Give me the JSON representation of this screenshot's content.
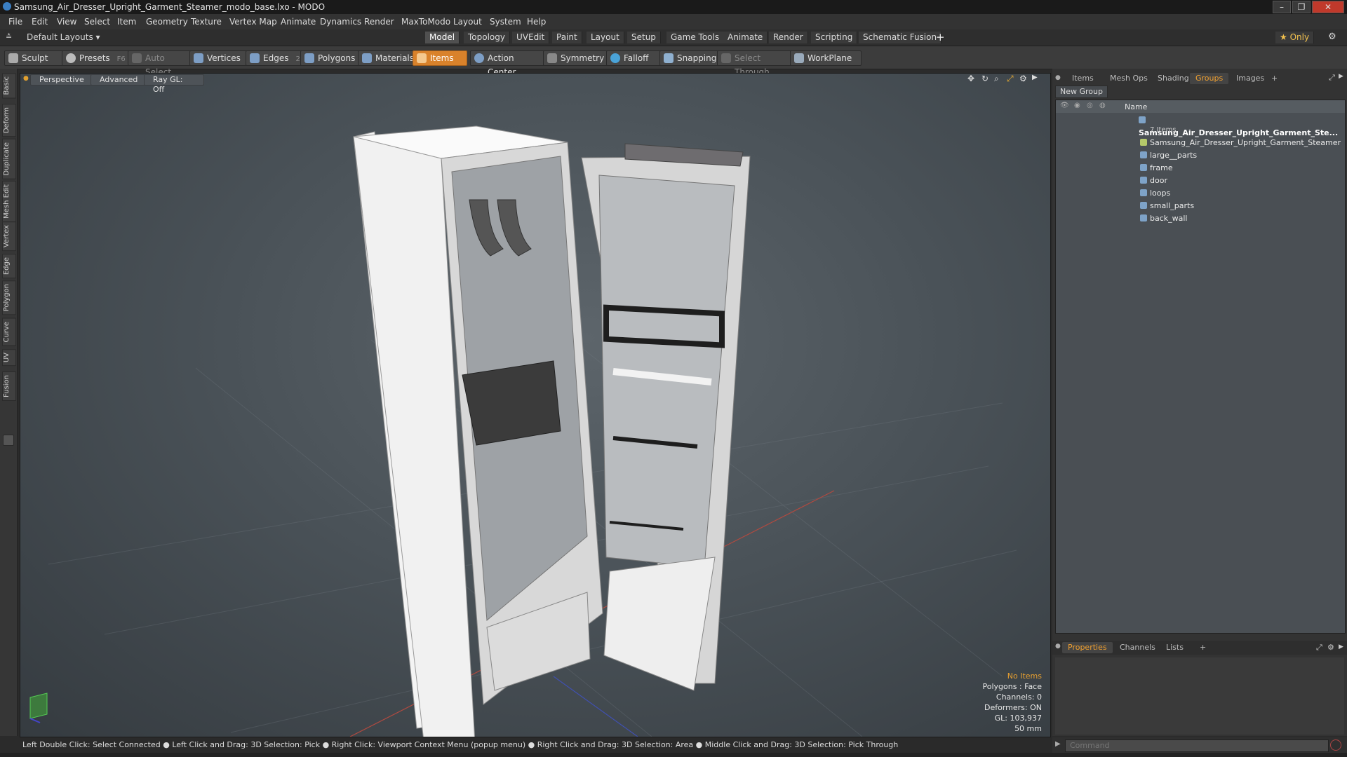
{
  "window": {
    "title": "Samsung_Air_Dresser_Upright_Garment_Steamer_modo_base.lxo - MODO",
    "minimize_glyph": "–",
    "maximize_glyph": "❐",
    "close_glyph": "✕"
  },
  "menu": {
    "items": [
      "File",
      "Edit",
      "View",
      "Select",
      "Item",
      "Geometry",
      "Texture",
      "Vertex Map",
      "Animate",
      "Dynamics",
      "Render",
      "MaxToModo",
      "Layout",
      "System",
      "Help"
    ]
  },
  "layoutbar": {
    "layout_selector": "Default Layouts ▾",
    "tabs": [
      "Model",
      "Topology",
      "UVEdit",
      "Paint",
      "Layout",
      "Setup",
      "Game Tools",
      "Animate",
      "Render",
      "Scripting",
      "Schematic Fusion"
    ],
    "active_tab": "Model",
    "add_tab": "+",
    "only_label": "★  Only",
    "gear_glyph": "⚙"
  },
  "toolbar": {
    "sculpt": "Sculpt",
    "presets": "Presets",
    "presets_key": "F6",
    "auto_select": "Auto Select",
    "vertices": "Vertices",
    "vertices_key": "1",
    "edges": "Edges",
    "edges_key": "2",
    "polygons": "Polygons",
    "materials": "Materials",
    "items": "Items",
    "action_center": "Action Center",
    "symmetry": "Symmetry",
    "falloff": "Falloff",
    "snapping": "Snapping",
    "select_through": "Select Through",
    "workplane": "WorkPlane"
  },
  "left_tabs": [
    "Basic",
    "Deform",
    "Duplicate",
    "Mesh Edit",
    "Vertex",
    "Edge",
    "Polygon",
    "Curve",
    "UV",
    "Fusion"
  ],
  "viewport": {
    "view_mode": "Perspective",
    "shading": "Advanced",
    "raygl": "Ray GL: Off",
    "info": {
      "no_items": "No Items",
      "polygons": "Polygons : Face",
      "channels": "Channels: 0",
      "deformers": "Deformers: ON",
      "gl": "GL: 103,937",
      "scale": "50 mm"
    }
  },
  "statusbar": {
    "text": "Left Double Click: Select Connected ● Left Click and Drag: 3D Selection: Pick ● Right Click: Viewport Context Menu (popup menu) ● Right Click and Drag: 3D Selection: Area ● Middle Click and Drag: 3D Selection: Pick Through"
  },
  "right_panel": {
    "tabs": [
      "Items",
      "Mesh Ops",
      "Shading",
      "Groups",
      "Images"
    ],
    "active_tab": "Groups",
    "add_tab": "+",
    "new_group": "New Group",
    "tree_header_name": "Name",
    "root": {
      "label": "Samsung_Air_Dresser_Upright_Garment_Ste...",
      "count": "7 Items"
    },
    "children": [
      "Samsung_Air_Dresser_Upright_Garment_Steamer",
      "large__parts",
      "frame",
      "door",
      "loops",
      "small_parts",
      "back_wall"
    ],
    "bottom_tabs": [
      "Properties",
      "Channels",
      "Lists"
    ],
    "bottom_active": "Properties",
    "command_placeholder": "Command"
  },
  "colors": {
    "accent_orange": "#d9822b",
    "active_tab_text": "#f0a030",
    "viewport_bg": "#4a5258"
  }
}
